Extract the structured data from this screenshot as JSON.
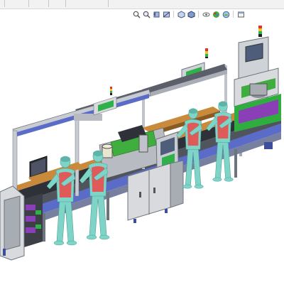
{
  "app": {
    "command_tabs": [
      "",
      "",
      "",
      "",
      ""
    ]
  },
  "heads_up_toolbar": {
    "tools": [
      {
        "icon": "zoom-to-fit-icon"
      },
      {
        "icon": "zoom-to-area-icon"
      },
      {
        "icon": "previous-view-icon"
      },
      {
        "icon": "section-view-icon"
      },
      {
        "icon": "view-orientation-icon"
      },
      {
        "icon": "display-style-icon"
      },
      {
        "icon": "hide-show-items-icon"
      },
      {
        "icon": "edit-appearance-icon"
      },
      {
        "icon": "apply-scene-icon"
      },
      {
        "icon": "view-settings-icon"
      }
    ]
  },
  "model": {
    "description_visible": false,
    "colors": {
      "frame": "#c8ccd2",
      "frame_dark": "#6e747c",
      "beam_top": "#5a5f69",
      "beam_blue": "#5a6cc8",
      "conveyor_wood": "#c98a3c",
      "conveyor_dark": "#2e3138",
      "machine_green": "#3fae3f",
      "operator_skin": "#7fd4c8",
      "operator_vest": "#e05a5a",
      "cabinet": "#d8dade",
      "cabinet_blue": "#3e4e9a",
      "purple": "#8a3fb6",
      "signal_red": "#e03030",
      "signal_yellow": "#e8c81a",
      "signal_green": "#2fb04a"
    }
  }
}
